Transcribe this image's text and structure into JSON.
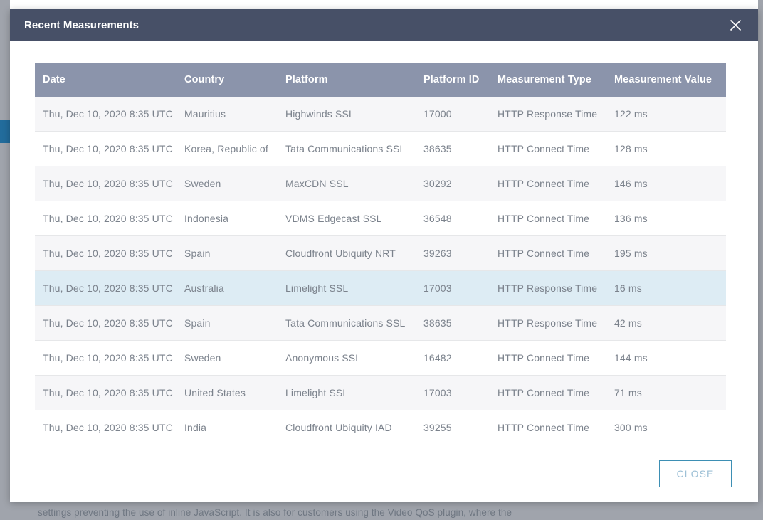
{
  "background": {
    "bottom_text": "settings preventing the use of inline JavaScript. It is also for customers using the Video QoS plugin, where the"
  },
  "modal": {
    "title": "Recent Measurements",
    "close_icon": "close-icon",
    "footer": {
      "close_label": "CLOSE"
    },
    "table": {
      "columns": [
        "Date",
        "Country",
        "Platform",
        "Platform ID",
        "Measurement Type",
        "Measurement Value"
      ],
      "rows": [
        {
          "date": "Thu, Dec 10, 2020 8:35 UTC",
          "country": "Mauritius",
          "platform": "Highwinds SSL",
          "platform_id": "17000",
          "measurement_type": "HTTP Response Time",
          "measurement_value": "122 ms",
          "state": "alt"
        },
        {
          "date": "Thu, Dec 10, 2020 8:35 UTC",
          "country": "Korea, Republic of",
          "platform": "Tata Communications SSL",
          "platform_id": "38635",
          "measurement_type": "HTTP Connect Time",
          "measurement_value": "128 ms",
          "state": "plain"
        },
        {
          "date": "Thu, Dec 10, 2020 8:35 UTC",
          "country": "Sweden",
          "platform": "MaxCDN SSL",
          "platform_id": "30292",
          "measurement_type": "HTTP Connect Time",
          "measurement_value": "146 ms",
          "state": "alt"
        },
        {
          "date": "Thu, Dec 10, 2020 8:35 UTC",
          "country": "Indonesia",
          "platform": "VDMS Edgecast SSL",
          "platform_id": "36548",
          "measurement_type": "HTTP Connect Time",
          "measurement_value": "136 ms",
          "state": "plain"
        },
        {
          "date": "Thu, Dec 10, 2020 8:35 UTC",
          "country": "Spain",
          "platform": "Cloudfront Ubiquity NRT",
          "platform_id": "39263",
          "measurement_type": "HTTP Connect Time",
          "measurement_value": "195 ms",
          "state": "alt"
        },
        {
          "date": "Thu, Dec 10, 2020 8:35 UTC",
          "country": "Australia",
          "platform": "Limelight SSL",
          "platform_id": "17003",
          "measurement_type": "HTTP Response Time",
          "measurement_value": "16 ms",
          "state": "highlighted"
        },
        {
          "date": "Thu, Dec 10, 2020 8:35 UTC",
          "country": "Spain",
          "platform": "Tata Communications SSL",
          "platform_id": "38635",
          "measurement_type": "HTTP Response Time",
          "measurement_value": "42 ms",
          "state": "alt"
        },
        {
          "date": "Thu, Dec 10, 2020 8:35 UTC",
          "country": "Sweden",
          "platform": "Anonymous SSL",
          "platform_id": "16482",
          "measurement_type": "HTTP Connect Time",
          "measurement_value": "144 ms",
          "state": "plain"
        },
        {
          "date": "Thu, Dec 10, 2020 8:35 UTC",
          "country": "United States",
          "platform": "Limelight SSL",
          "platform_id": "17003",
          "measurement_type": "HTTP Connect Time",
          "measurement_value": "71 ms",
          "state": "alt"
        },
        {
          "date": "Thu, Dec 10, 2020 8:35 UTC",
          "country": "India",
          "platform": "Cloudfront Ubiquity IAD",
          "platform_id": "39255",
          "measurement_type": "HTTP Connect Time",
          "measurement_value": "300 ms",
          "state": "plain"
        }
      ]
    }
  },
  "colors": {
    "modal_header_bg": "#475067",
    "table_header_bg": "#8b94ab",
    "row_alt_bg": "#f6f6f8",
    "row_highlight_bg": "#ddecf4",
    "accent_blue": "#3d8fb4",
    "left_tab_blue": "#226c9c",
    "page_backdrop": "#a0a4ac"
  }
}
